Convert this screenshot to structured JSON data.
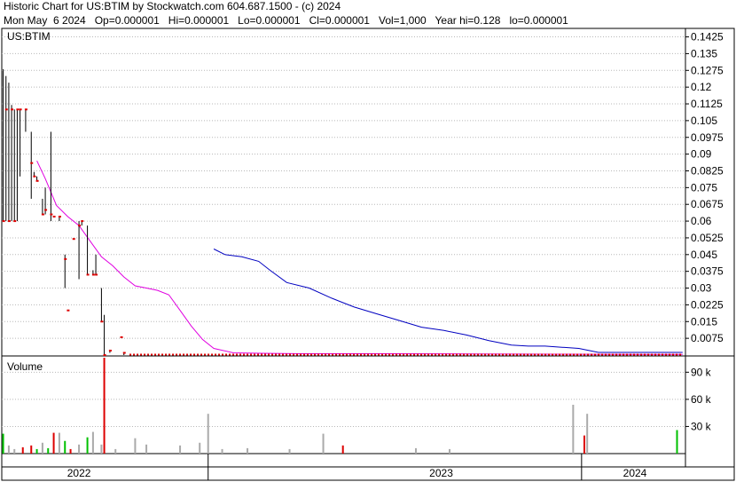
{
  "title": "Historic Chart for US:BTIM by Stockwatch.com 604.687.1500 - (c) 2024",
  "summary": "Mon May  6 2024   Op=0.000001   Hi=0.000001   Lo=0.000001   Cl=0.000001   Vol=1,000   Year hi=0.128   lo=0.000001",
  "chart_data": [
    {
      "type": "candlestick",
      "symbol_label": "US:BTIM",
      "y_ticks": [
        "0.1425",
        "0.135",
        "0.1275",
        "0.12",
        "0.1125",
        "0.105",
        "0.0975",
        "0.09",
        "0.0825",
        "0.075",
        "0.0675",
        "0.06",
        "0.0525",
        "0.045",
        "0.0375",
        "0.03",
        "0.0225",
        "0.015",
        "0.0075"
      ],
      "ylim": [
        0,
        0.1463
      ],
      "grid": true,
      "price_bars": [
        {
          "x": 2021.93,
          "h": 0.128,
          "l": 0.06,
          "c": 0.06
        },
        {
          "x": 2021.94,
          "h": 0.125,
          "l": 0.06,
          "c": 0.11
        },
        {
          "x": 2021.95,
          "h": 0.122,
          "l": 0.06,
          "c": 0.06
        },
        {
          "x": 2021.96,
          "h": 0.112,
          "l": 0.06,
          "c": 0.11
        },
        {
          "x": 2021.97,
          "h": 0.11,
          "l": 0.06,
          "c": 0.06
        },
        {
          "x": 2021.98,
          "h": 0.11,
          "l": 0.06,
          "c": 0.11
        },
        {
          "x": 2021.99,
          "h": 0.11,
          "l": 0.08,
          "c": 0.11
        },
        {
          "x": 2022.01,
          "h": 0.11,
          "l": 0.1,
          "c": 0.11
        },
        {
          "x": 2022.03,
          "h": 0.1,
          "l": 0.07,
          "c": 0.086
        },
        {
          "x": 2022.04,
          "h": 0.082,
          "l": 0.08,
          "c": 0.08
        },
        {
          "x": 2022.05,
          "h": 0.08,
          "l": 0.078,
          "c": 0.078
        },
        {
          "x": 2022.07,
          "h": 0.07,
          "l": 0.063,
          "c": 0.063
        },
        {
          "x": 2022.08,
          "h": 0.075,
          "l": 0.063,
          "c": 0.065
        },
        {
          "x": 2022.1,
          "h": 0.1,
          "l": 0.06,
          "c": 0.063
        },
        {
          "x": 2022.11,
          "h": 0.062,
          "l": 0.062,
          "c": 0.062
        },
        {
          "x": 2022.13,
          "h": 0.062,
          "l": 0.06,
          "c": 0.062
        },
        {
          "x": 2022.15,
          "h": 0.045,
          "l": 0.03,
          "c": 0.043
        },
        {
          "x": 2022.16,
          "h": 0.02,
          "l": 0.02,
          "c": 0.02
        },
        {
          "x": 2022.18,
          "h": 0.052,
          "l": 0.052,
          "c": 0.052
        },
        {
          "x": 2022.2,
          "h": 0.06,
          "l": 0.034,
          "c": 0.058
        },
        {
          "x": 2022.21,
          "h": 0.06,
          "l": 0.058,
          "c": 0.06
        },
        {
          "x": 2022.23,
          "h": 0.058,
          "l": 0.036,
          "c": 0.036
        },
        {
          "x": 2022.25,
          "h": 0.038,
          "l": 0.036,
          "c": 0.036
        },
        {
          "x": 2022.26,
          "h": 0.045,
          "l": 0.036,
          "c": 0.036
        },
        {
          "x": 2022.28,
          "h": 0.03,
          "l": 0.015,
          "c": 0.015
        },
        {
          "x": 2022.29,
          "h": 0.018,
          "l": 0.0,
          "c": 0.0
        },
        {
          "x": 2022.31,
          "h": 0.002,
          "l": 0.001,
          "c": 0.002
        },
        {
          "x": 2022.35,
          "h": 0.008,
          "l": 0.008,
          "c": 0.008
        },
        {
          "x": 2022.36,
          "h": 0.001,
          "l": 0.0,
          "c": 0.001
        }
      ],
      "flat_price_segment": {
        "x_start": 2022.38,
        "x_end": 2024.35,
        "value": 0.0002
      },
      "moving_average_short": {
        "color": "#e000e0",
        "x": [
          2022.05,
          2022.08,
          2022.12,
          2022.16,
          2022.2,
          2022.24,
          2022.28,
          2022.32,
          2022.36,
          2022.4,
          2022.44,
          2022.48,
          2022.52,
          2022.56,
          2022.6,
          2022.64,
          2022.68,
          2022.75,
          2022.85,
          2023.0,
          2023.3,
          2023.6,
          2023.9,
          2024.2,
          2024.35
        ],
        "y": [
          0.087,
          0.079,
          0.067,
          0.062,
          0.058,
          0.051,
          0.044,
          0.04,
          0.035,
          0.031,
          0.03,
          0.029,
          0.027,
          0.02,
          0.013,
          0.007,
          0.003,
          0.001,
          0.0008,
          0.0006,
          0.0006,
          0.0005,
          0.0004,
          0.0003,
          0.0003
        ]
      },
      "moving_average_long": {
        "color": "#0000c0",
        "x": [
          2022.68,
          2022.72,
          2022.78,
          2022.84,
          2022.88,
          2022.94,
          2023.02,
          2023.1,
          2023.18,
          2023.26,
          2023.34,
          2023.42,
          2023.5,
          2023.58,
          2023.66,
          2023.74,
          2023.8,
          2023.86,
          2023.92,
          2023.98,
          2024.05,
          2024.15,
          2024.25,
          2024.35
        ],
        "y": [
          0.0475,
          0.045,
          0.044,
          0.042,
          0.038,
          0.0325,
          0.03,
          0.0255,
          0.0215,
          0.0185,
          0.0155,
          0.0125,
          0.011,
          0.009,
          0.0065,
          0.0045,
          0.004,
          0.004,
          0.0035,
          0.003,
          0.0012,
          0.0012,
          0.0012,
          0.0012
        ]
      }
    },
    {
      "type": "bar",
      "label": "Volume",
      "y_ticks": [
        "90 k",
        "60 k",
        "30 k"
      ],
      "ylim": [
        0,
        107000
      ],
      "bars": [
        {
          "x": 2021.93,
          "v": 22000,
          "c": "#00c000"
        },
        {
          "x": 2021.95,
          "v": 9000,
          "c": "#aaaaaa"
        },
        {
          "x": 2021.97,
          "v": 5000,
          "c": "#aaaaaa"
        },
        {
          "x": 2022.0,
          "v": 7000,
          "c": "#dd0000"
        },
        {
          "x": 2022.03,
          "v": 9000,
          "c": "#dd0000"
        },
        {
          "x": 2022.05,
          "v": 5000,
          "c": "#00c000"
        },
        {
          "x": 2022.07,
          "v": 12000,
          "c": "#aaaaaa"
        },
        {
          "x": 2022.09,
          "v": 6000,
          "c": "#00c000"
        },
        {
          "x": 2022.11,
          "v": 23000,
          "c": "#dd0000"
        },
        {
          "x": 2022.13,
          "v": 23000,
          "c": "#aaaaaa"
        },
        {
          "x": 2022.15,
          "v": 14000,
          "c": "#00c000"
        },
        {
          "x": 2022.17,
          "v": 5000,
          "c": "#dd0000"
        },
        {
          "x": 2022.2,
          "v": 10000,
          "c": "#aaaaaa"
        },
        {
          "x": 2022.23,
          "v": 18000,
          "c": "#00c000"
        },
        {
          "x": 2022.25,
          "v": 24000,
          "c": "#aaaaaa"
        },
        {
          "x": 2022.28,
          "v": 10000,
          "c": "#aaaaaa"
        },
        {
          "x": 2022.29,
          "v": 106000,
          "c": "#dd0000"
        },
        {
          "x": 2022.33,
          "v": 5000,
          "c": "#aaaaaa"
        },
        {
          "x": 2022.4,
          "v": 17000,
          "c": "#aaaaaa"
        },
        {
          "x": 2022.44,
          "v": 10000,
          "c": "#aaaaaa"
        },
        {
          "x": 2022.56,
          "v": 9000,
          "c": "#aaaaaa"
        },
        {
          "x": 2022.63,
          "v": 12000,
          "c": "#aaaaaa"
        },
        {
          "x": 2022.66,
          "v": 44000,
          "c": "#aaaaaa"
        },
        {
          "x": 2022.71,
          "v": 5000,
          "c": "#aaaaaa"
        },
        {
          "x": 2022.8,
          "v": 6000,
          "c": "#aaaaaa"
        },
        {
          "x": 2022.95,
          "v": 5000,
          "c": "#aaaaaa"
        },
        {
          "x": 2023.07,
          "v": 22000,
          "c": "#aaaaaa"
        },
        {
          "x": 2023.14,
          "v": 9000,
          "c": "#dd0000"
        },
        {
          "x": 2023.4,
          "v": 6000,
          "c": "#aaaaaa"
        },
        {
          "x": 2023.52,
          "v": 5000,
          "c": "#aaaaaa"
        },
        {
          "x": 2023.96,
          "v": 54000,
          "c": "#aaaaaa"
        },
        {
          "x": 2024.0,
          "v": 20000,
          "c": "#dd0000"
        },
        {
          "x": 2024.01,
          "v": 44000,
          "c": "#aaaaaa"
        },
        {
          "x": 2024.33,
          "v": 26000,
          "c": "#00c000"
        }
      ]
    }
  ],
  "x_axis": {
    "labels": [
      {
        "text": "2022",
        "x": 2022.2
      },
      {
        "text": "2023",
        "x": 2023.49
      },
      {
        "text": "2024",
        "x": 2024.18
      }
    ],
    "year_boundaries": [
      2022.66,
      2023.99
    ]
  }
}
